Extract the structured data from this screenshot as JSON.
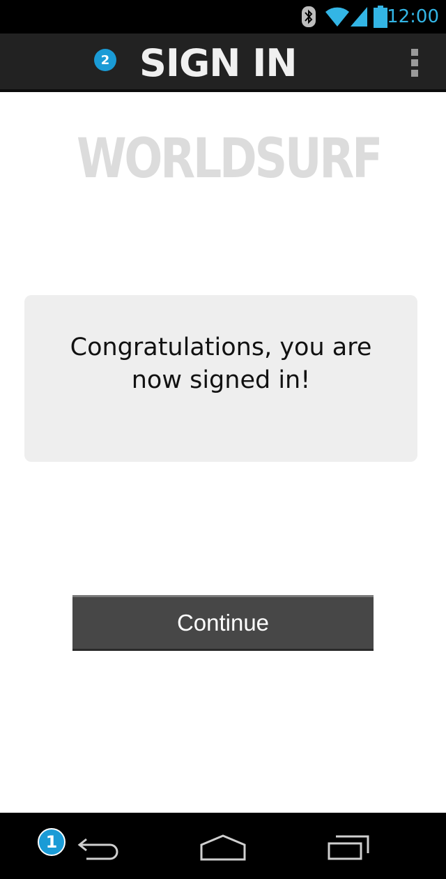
{
  "status_bar": {
    "time": "12:00",
    "icons": [
      "bluetooth-icon",
      "wifi-icon",
      "signal-icon",
      "battery-icon"
    ],
    "accent_color": "#33b5e5"
  },
  "action_bar": {
    "badge": "2",
    "title": "SIGN IN",
    "overflow_icon": "overflow-menu-icon"
  },
  "logo": {
    "text": "WORLDSURF"
  },
  "message": {
    "text": "Congratulations, you are now signed in!"
  },
  "continue_button": {
    "label": "Continue"
  },
  "nav_bar": {
    "badge": "1",
    "icons": [
      "back-icon",
      "home-icon",
      "recent-apps-icon"
    ]
  },
  "colors": {
    "badge": "#1a9bd6",
    "action_bar": "#222222",
    "message_box": "#eeeeee",
    "button": "#474747",
    "logo": "#dcdcdc"
  }
}
